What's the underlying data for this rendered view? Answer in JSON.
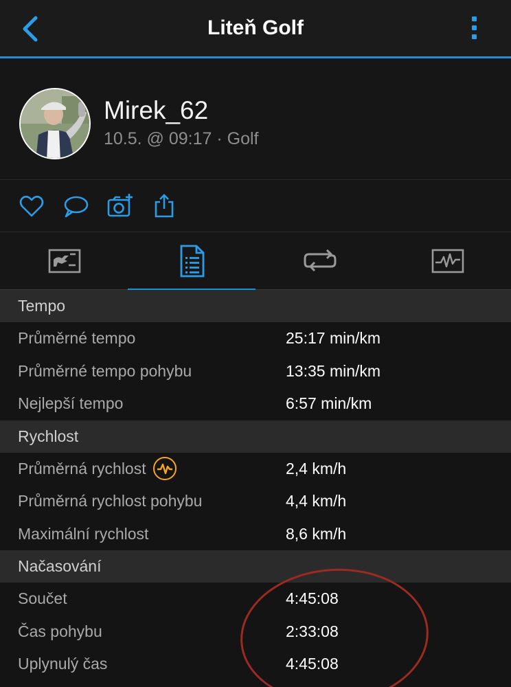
{
  "header": {
    "title": "Liteň Golf",
    "back_icon": "chevron-left-icon",
    "more_icon": "vertical-dots-icon",
    "accent": "#1d8fd6"
  },
  "profile": {
    "name": "Mirek_62",
    "meta": "10.5. @ 09:17 · Golf"
  },
  "actions": [
    {
      "icon": "heart-icon"
    },
    {
      "icon": "comment-icon"
    },
    {
      "icon": "add-photo-icon"
    },
    {
      "icon": "share-icon"
    }
  ],
  "tabs": [
    {
      "icon": "scorecard-icon",
      "active": false
    },
    {
      "icon": "stats-list-icon",
      "active": true
    },
    {
      "icon": "laps-icon",
      "active": false
    },
    {
      "icon": "chart-icon",
      "active": false
    }
  ],
  "sections": {
    "tempo": {
      "title": "Tempo",
      "rows": [
        {
          "label": "Průměrné tempo",
          "value": "25:17 min/km"
        },
        {
          "label": "Průměrné tempo pohybu",
          "value": "13:35 min/km"
        },
        {
          "label": "Nejlepší tempo",
          "value": "6:57 min/km"
        }
      ]
    },
    "speed": {
      "title": "Rychlost",
      "rows": [
        {
          "label": "Průměrná rychlost",
          "value": "2,4 km/h"
        },
        {
          "label": "Průměrná rychlost pohybu",
          "value": "4,4 km/h"
        },
        {
          "label": "Maximální rychlost",
          "value": "8,6 km/h"
        }
      ]
    },
    "timing": {
      "title": "Načasování",
      "rows": [
        {
          "label": "Součet",
          "value": "4:45:08"
        },
        {
          "label": "Čas pohybu",
          "value": "2:33:08"
        },
        {
          "label": "Uplynulý čas",
          "value": "4:45:08"
        }
      ]
    }
  },
  "colors": {
    "background": "#141414",
    "section_header": "#2b2b2b",
    "icon_blue": "#2b9de8",
    "badge_orange": "#f5a623",
    "annotation_red": "#9b2b20"
  }
}
